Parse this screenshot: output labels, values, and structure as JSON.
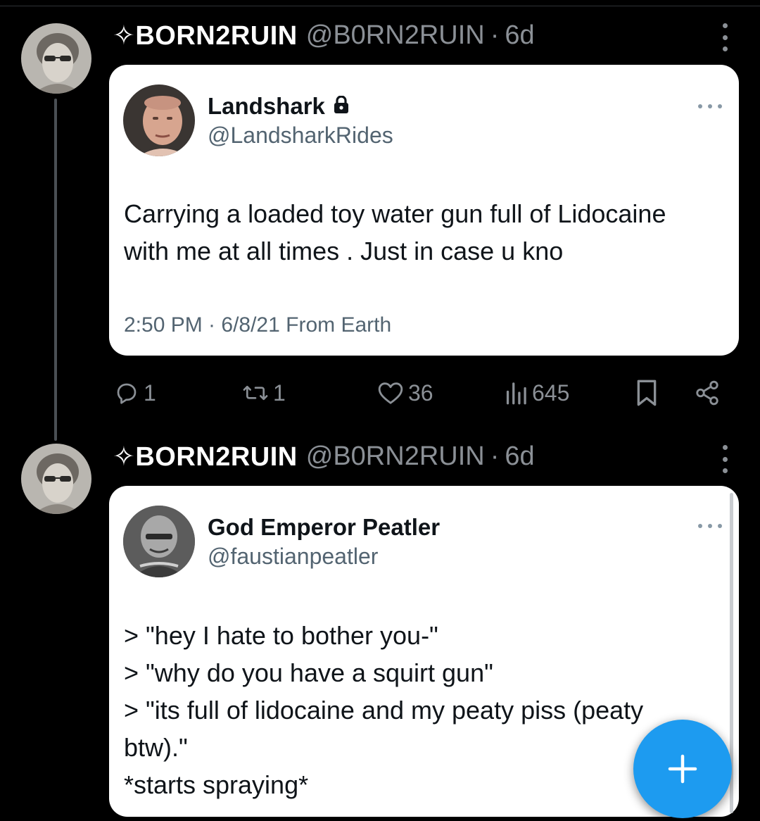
{
  "tweets": [
    {
      "author": {
        "name": "✧BORN2RUIN",
        "handle": "@B0RN2RUIN",
        "separator": "·",
        "age": "6d"
      },
      "quoted": {
        "name": "Landshark",
        "handle": "@LandsharkRides",
        "protected_icon": "lock-icon",
        "lines": [
          "Carrying a loaded toy water gun full of Lidocaine",
          "with me at all times .  Just in case u kno"
        ],
        "meta": "2:50 PM · 6/8/21 From Earth"
      },
      "stats": {
        "replies": "1",
        "reposts": "1",
        "likes": "36",
        "views": "645"
      }
    },
    {
      "author": {
        "name": "✧BORN2RUIN",
        "handle": "@B0RN2RUIN",
        "separator": "·",
        "age": "6d"
      },
      "quoted": {
        "name": "God Emperor Peatler",
        "handle": "@faustianpeatler",
        "lines": [
          "> \"hey I hate to bother you-\"",
          "> \"why do you have a squirt gun\"",
          "> \"its full of lidocaine and my peaty piss (peaty",
          "btw).\"",
          "*starts spraying*"
        ]
      }
    }
  ],
  "fab": {
    "label": "+",
    "icon": "plus-icon"
  },
  "colors": {
    "background": "#000000",
    "card": "#ffffff",
    "muted": "#8b9096",
    "accent": "#1d9bf0"
  }
}
